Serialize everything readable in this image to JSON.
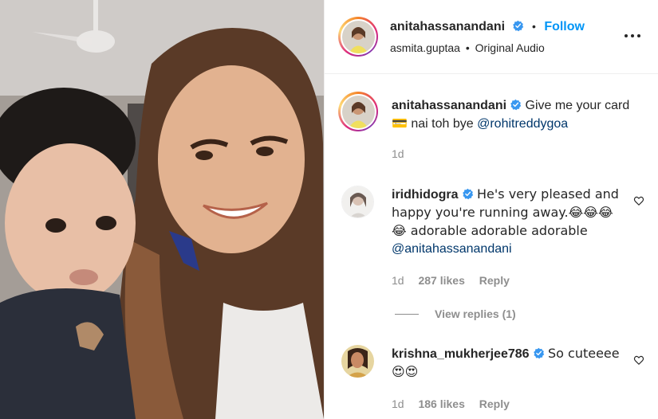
{
  "post": {
    "author": "anitahassanandani",
    "follow_label": "Follow",
    "separator": "•",
    "audio_user": "asmita.guptaa",
    "audio_label": "Original Audio"
  },
  "caption": {
    "username": "anitahassanandani",
    "text": "Give me your card",
    "emoji": "💳",
    "text2": "nai toh bye",
    "mention": "@rohitreddygoa",
    "time": "1d"
  },
  "comments": [
    {
      "username": "iridhidogra",
      "text": "He's very pleased and happy you're running away.😂😂😂😂 adorable adorable adorable",
      "mention": "@anitahassanandani",
      "time": "1d",
      "likes": "287 likes",
      "reply_label": "Reply",
      "view_replies": "View replies (1)"
    },
    {
      "username": "krishna_mukherjee786",
      "text": "So cuteeee😍😍",
      "time": "1d",
      "likes": "186 likes",
      "reply_label": "Reply"
    }
  ],
  "colors": {
    "accent": "#0095f6",
    "verified": "#3897f0",
    "mention": "#00376b",
    "muted": "#8e8e8e"
  }
}
